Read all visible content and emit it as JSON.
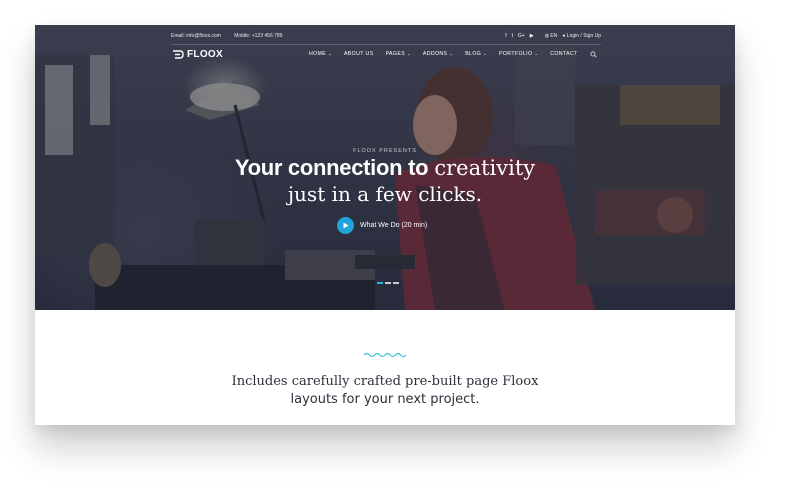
{
  "topbar": {
    "email": "Email: info@floox.com",
    "mobile": "Mobile: +123 456 789",
    "social_icons": [
      "facebook-icon",
      "twitter-icon",
      "google-plus-icon",
      "youtube-icon"
    ],
    "social_glyphs": [
      "f",
      "t",
      "G+",
      "▶"
    ],
    "language": "EN",
    "login": "Login / Sign Up"
  },
  "brand": {
    "name": "FLOOX"
  },
  "nav": {
    "items": [
      {
        "label": "HOME",
        "has_dropdown": true
      },
      {
        "label": "ABOUT US",
        "has_dropdown": false
      },
      {
        "label": "PAGES",
        "has_dropdown": true
      },
      {
        "label": "ADDONS",
        "has_dropdown": true
      },
      {
        "label": "BLOG",
        "has_dropdown": true
      },
      {
        "label": "PORTFOLIO",
        "has_dropdown": true
      },
      {
        "label": "CONTACT",
        "has_dropdown": false
      }
    ],
    "chevron": "⌄"
  },
  "hero": {
    "eyebrow": "FLOOX PRESENTS",
    "headline_bold": "Your connection to",
    "headline_serif": "creativity",
    "headline_line2": "just in a few clicks.",
    "video_label": "What We Do (20 min)",
    "slider_count": 3,
    "active_slide": 1
  },
  "section": {
    "line1": "Includes carefully crafted pre-built page Floox",
    "line2": "layouts for your next project."
  },
  "colors": {
    "accent": "#1fa3d8",
    "wave": "#3fc2d8",
    "text_dark": "#2d2f3b",
    "hero_overlay": "#1c2034"
  }
}
